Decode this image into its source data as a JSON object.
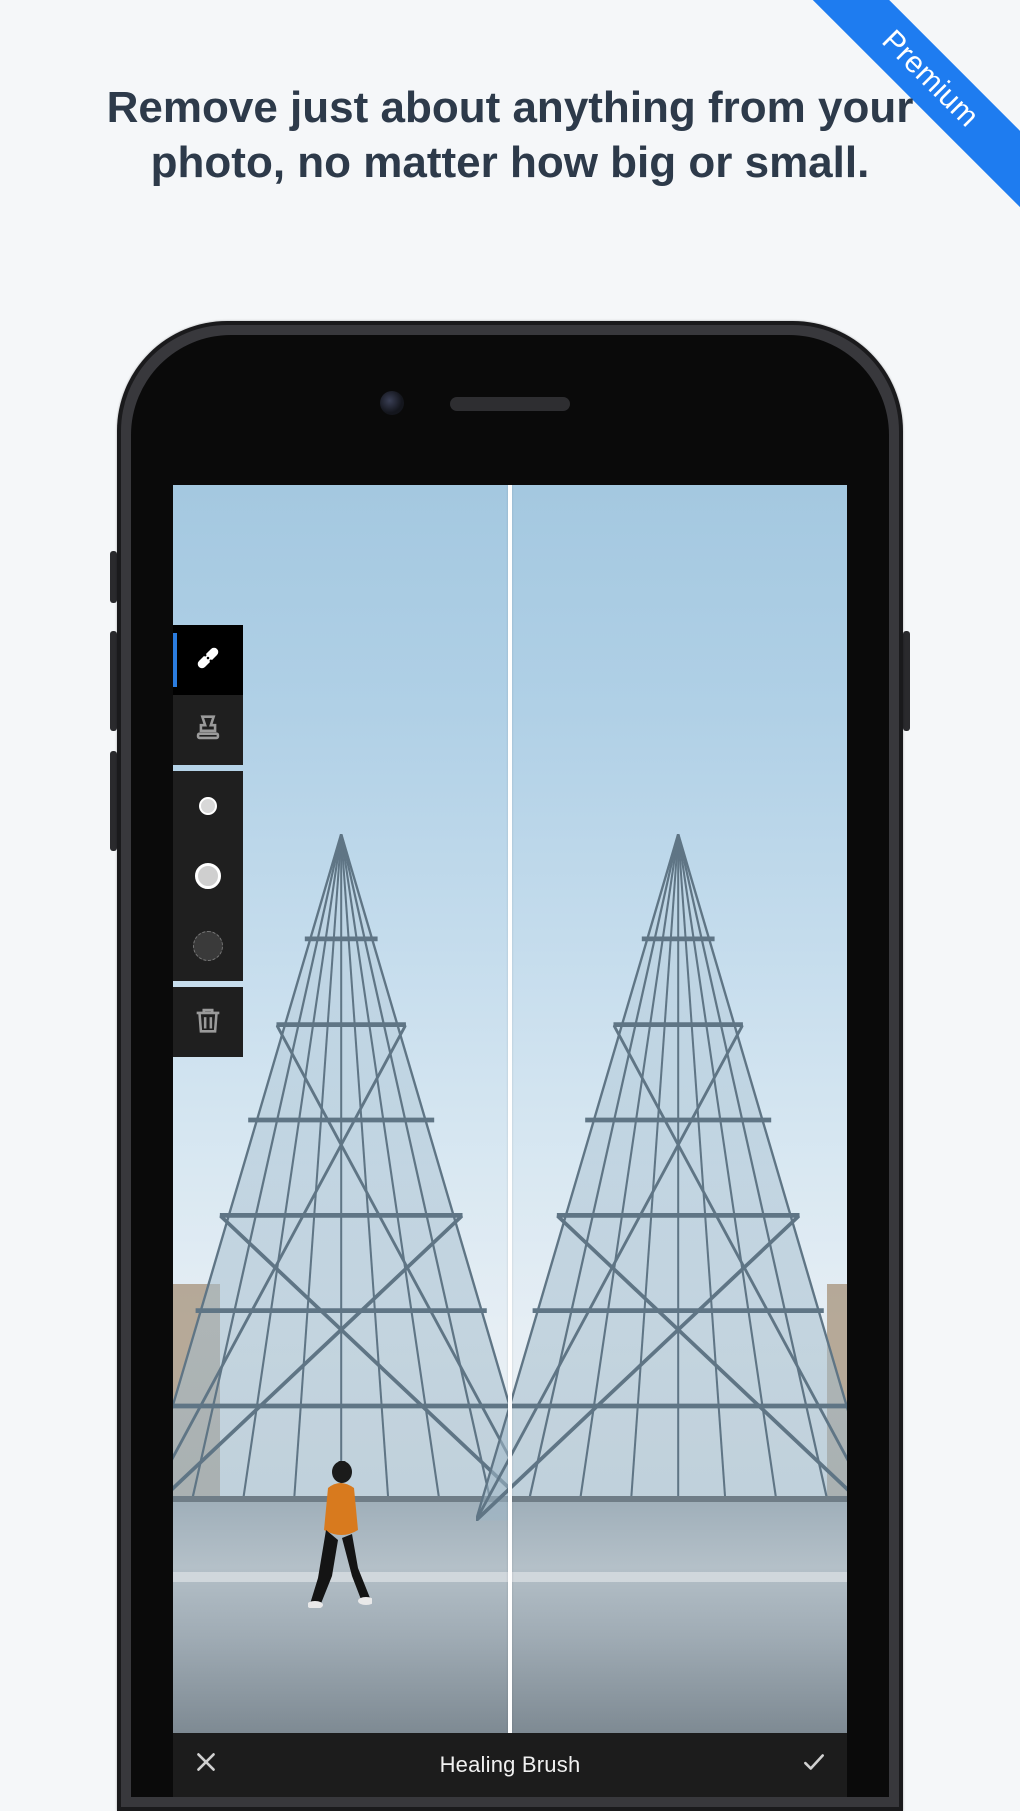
{
  "ribbon": {
    "label": "Premium"
  },
  "headline": "Remove just about anything from your photo, no matter how big or small.",
  "toolbar": {
    "tools": [
      {
        "name": "healing-brush-tool",
        "active": true
      },
      {
        "name": "clone-stamp-tool",
        "active": false
      }
    ],
    "brush_sizes": [
      {
        "name": "brush-size-small"
      },
      {
        "name": "brush-size-medium"
      },
      {
        "name": "brush-size-hard"
      }
    ],
    "trash": {
      "name": "delete-spot"
    }
  },
  "appbar": {
    "cancel_label": "Cancel",
    "title": "Healing Brush",
    "confirm_label": "Apply"
  }
}
